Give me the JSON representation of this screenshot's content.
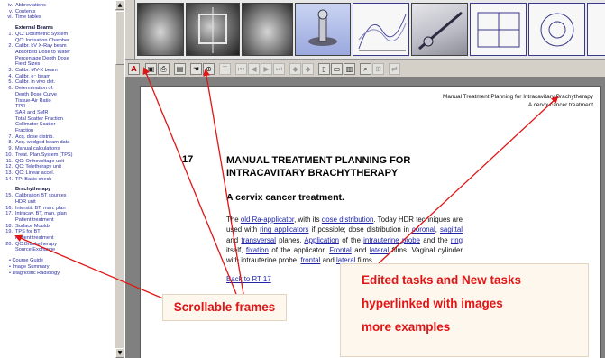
{
  "left_nav": {
    "top_items": [
      {
        "num": "iv.",
        "label": "Abbreviations"
      },
      {
        "num": "v.",
        "label": "Contents"
      },
      {
        "num": "vi.",
        "label": "Time tables"
      }
    ],
    "external_beams": {
      "heading": "External Beams",
      "items": [
        {
          "num": "1.",
          "label": "QC: Dosimetric System",
          "sub": [
            "QC: Ionisation Chamber"
          ]
        },
        {
          "num": "2.",
          "label": "Calibr. kV X-Ray beam",
          "sub": [
            "Absorbed Dose to Water",
            "Percentage Depth Dose",
            "Field Sizes"
          ]
        },
        {
          "num": "3.",
          "label": "Calibr. MV-X beam",
          "sub": []
        },
        {
          "num": "4.",
          "label": "Calibr. e⁻ beam",
          "sub": []
        },
        {
          "num": "5.",
          "label": "Calibr. in vivo det.",
          "sub": []
        },
        {
          "num": "6.",
          "label": "Determination of:",
          "sub": [
            "Depth Dose Curve",
            "Tissue-Air Ratio",
            "TPR",
            "SAR and SMR",
            "Total Scatter Fraction",
            "Collimator Scatter",
            "Fraction"
          ]
        },
        {
          "num": "7.",
          "label": "Acq. dose distrib.",
          "sub": []
        },
        {
          "num": "8.",
          "label": "Acq. wedged beam data",
          "sub": []
        },
        {
          "num": "9.",
          "label": "Manual calculations",
          "sub": []
        },
        {
          "num": "10.",
          "label": "Treat. Plan.System (TPS)",
          "sub": []
        },
        {
          "num": "11.",
          "label": "QC: Orthovoltage unit",
          "sub": []
        },
        {
          "num": "12.",
          "label": "QC: Teletherapy unit",
          "sub": []
        },
        {
          "num": "13.",
          "label": "QC: Linear accel.",
          "sub": []
        },
        {
          "num": "14.",
          "label": "TP: Basic check",
          "sub": []
        }
      ]
    },
    "brachytherapy": {
      "heading": "Brachytherapy",
      "items": [
        {
          "num": "15.",
          "label": "Calibration BT sources",
          "sub": [
            "HDR unit"
          ]
        },
        {
          "num": "16.",
          "label": "Interstit. BT, man. plan",
          "sub": []
        },
        {
          "num": "17.",
          "label": "Intracav. BT, man. plan",
          "sub": [
            "Patient treatment"
          ]
        },
        {
          "num": "18.",
          "label": "Surface Moulds",
          "sub": []
        },
        {
          "num": "19.",
          "label": "TPS for BT",
          "sub": [
            "Patient treatment"
          ]
        },
        {
          "num": "20.",
          "label": "QC:Brachytherapy",
          "sub": [
            "Source Exchange"
          ]
        }
      ]
    },
    "footer_items": [
      "Course Guide",
      "Image Summary",
      "Diagnostic Radiology"
    ]
  },
  "document": {
    "header_line1": "Manual Treatment Planning for Intracavitary Brachytherapy",
    "header_line2": "A cervix cancer treatment",
    "section_number": "17",
    "title": "MANUAL TREATMENT PLANNING FOR INTRACAVITARY BRACHYTHERAPY",
    "subtitle": "A cervix cancer treatment.",
    "body": {
      "t1": "The ",
      "l1": "old Ra-applicator",
      "t2": ", with its ",
      "l2": "dose distribution",
      "t3": ". Today HDR techniques are used with ",
      "l3": "ring applicators",
      "t4": " if possible; dose distribution in ",
      "l4": "coronal",
      "t5": ", ",
      "l5": "sagittal",
      "t6": " and ",
      "l6": "transversal",
      "t7": " planes. ",
      "l7": "Application",
      "t8": " of the ",
      "l8": "intrauterine probe",
      "t9": " and the ",
      "l9": "ring",
      "t10": " itself, ",
      "l10": "fixation",
      "t11": " of the applicator. ",
      "l11": "Frontal",
      "t12": " and ",
      "l12": "lateral",
      "t13": " films. Vaginal cylinder with intrauterine probe, ",
      "l13": "frontal",
      "t14": " and ",
      "l14": "lateral",
      "t15": " films."
    },
    "back_link": "Back to RT 17"
  },
  "callouts": {
    "scrollable": "Scrollable frames",
    "line1": "Edited tasks and New tasks",
    "line2": "hyperlinked with images",
    "line3": "more examples"
  },
  "colors": {
    "link": "#1e24a8",
    "callout_text": "#e01515",
    "arrow": "#e01515"
  }
}
